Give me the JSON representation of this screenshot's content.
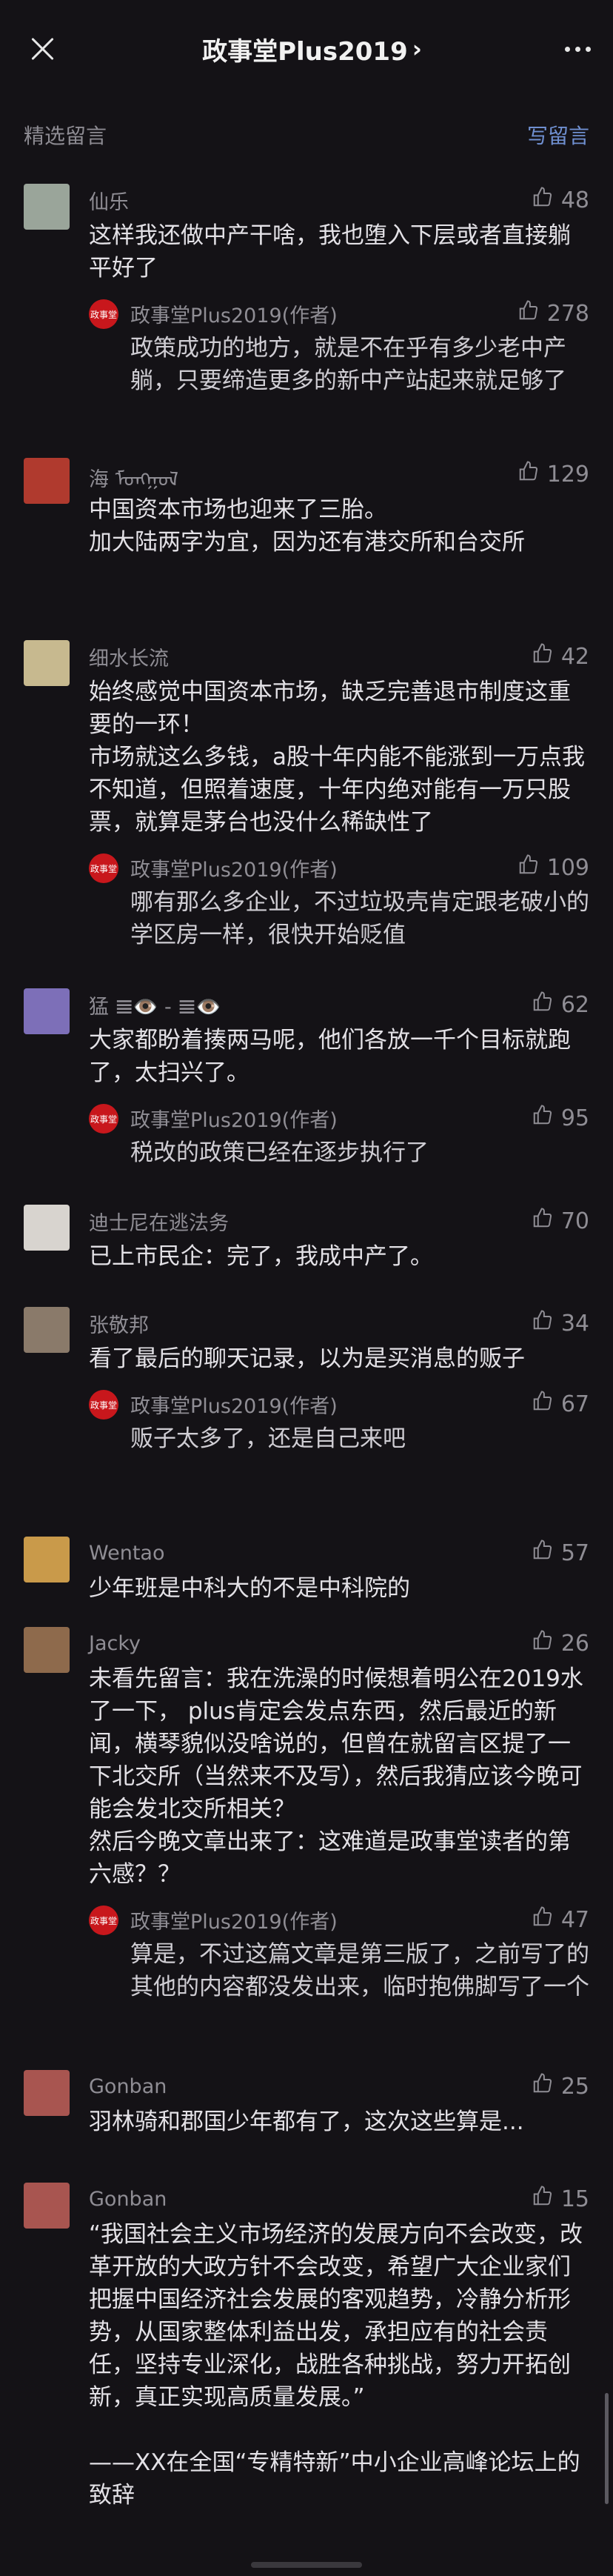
{
  "header": {
    "title": "政事堂Plus2019",
    "chevron": "›"
  },
  "section": {
    "title": "精选留言",
    "write_label": "写留言"
  },
  "comments": [
    {
      "name": "仙乐",
      "likes": "48",
      "text": "这样我还做中产干啥，我也堕入下层或者直接躺平好了",
      "avatar_color": "#9aa59a",
      "reply": {
        "name": "政事堂Plus2019(作者)",
        "likes": "278",
        "text": "政策成功的地方，就是不在乎有多少老中产躺，只要缔造更多的新中产站起来就足够了"
      }
    },
    {
      "name": "海 ᠮᠣᠩᠭᠣᠯ",
      "likes": "129",
      "text": "中国资本市场也迎来了三胎。\n加大陆两字为宜，因为还有港交所和台交所",
      "avatar_color": "#b03a2e",
      "reply": null
    },
    {
      "name": "细水长流",
      "likes": "42",
      "text": "始终感觉中国资本市场，缺乏完善退市制度这重要的一环！\n市场就这么多钱，a股十年内能不能涨到一万点我不知道，但照着速度，十年内绝对能有一万只股票，就算是茅台也没什么稀缺性了",
      "avatar_color": "#c7b98f",
      "reply": {
        "name": "政事堂Plus2019(作者)",
        "likes": "109",
        "text": "哪有那么多企业，不过垃圾壳肯定跟老破小的学区房一样，很快开始贬值"
      }
    },
    {
      "name": "猛 𝌆👁️ - 𝌆👁️",
      "likes": "62",
      "text": "大家都盼着揍两马呢，他们各放一千个目标就跑了，太扫兴了。",
      "avatar_color": "#7d6fb8",
      "reply": {
        "name": "政事堂Plus2019(作者)",
        "likes": "95",
        "text": "税改的政策已经在逐步执行了"
      }
    },
    {
      "name": "迪士尼在逃法务",
      "likes": "70",
      "text": "已上市民企：完了，我成中产了。",
      "avatar_color": "#d8d4cf",
      "reply": null
    },
    {
      "name": "张敬邦",
      "likes": "34",
      "text": "看了最后的聊天记录，以为是买消息的贩子",
      "avatar_color": "#8a7a6a",
      "reply": {
        "name": "政事堂Plus2019(作者)",
        "likes": "67",
        "text": "贩子太多了，还是自己来吧"
      }
    },
    {
      "name": "Wentao",
      "likes": "57",
      "text": "少年班是中科大的不是中科院的",
      "avatar_color": "#c99a4a",
      "reply": null
    },
    {
      "name": "Jacky",
      "likes": "26",
      "text": "未看先留言：我在洗澡的时候想着明公在2019水了一下， plus肯定会发点东西，然后最近的新闻，横琴貌似没啥说的，但曾在就留言区提了一下北交所（当然来不及写），然后我猜应该今晚可能会发北交所相关？\n然后今晚文章出来了：这难道是政事堂读者的第六感？？",
      "avatar_color": "#8e6a4c",
      "reply": {
        "name": "政事堂Plus2019(作者)",
        "likes": "47",
        "text": "算是，不过这篇文章是第三版了，之前写了的其他的内容都没发出来，临时抱佛脚写了一个"
      }
    },
    {
      "name": "Gonban",
      "likes": "25",
      "text": "羽林骑和郡国少年都有了，这次这些算是...",
      "avatar_color": "#a85550",
      "reply": null
    },
    {
      "name": "Gonban",
      "likes": "15",
      "text": "“我国社会主义市场经济的发展方向不会改变，改革开放的大政方针不会改变，希望广大企业家们把握中国经济社会发展的客观趋势，冷静分析形势，从国家整体利益出发，承担应有的社会责任，坚持专业深化，战胜各种挑战，努力开拓创新，真正实现高质量发展。”\n\n——XX在全国“专精特新”中小企业高峰论坛上的致辞",
      "avatar_color": "#a85550",
      "reply": null
    }
  ],
  "reply_avatar_text": "政事堂",
  "colors": {
    "background": "#141216",
    "link": "#6f8fd0",
    "author_badge": "#c8171c"
  }
}
